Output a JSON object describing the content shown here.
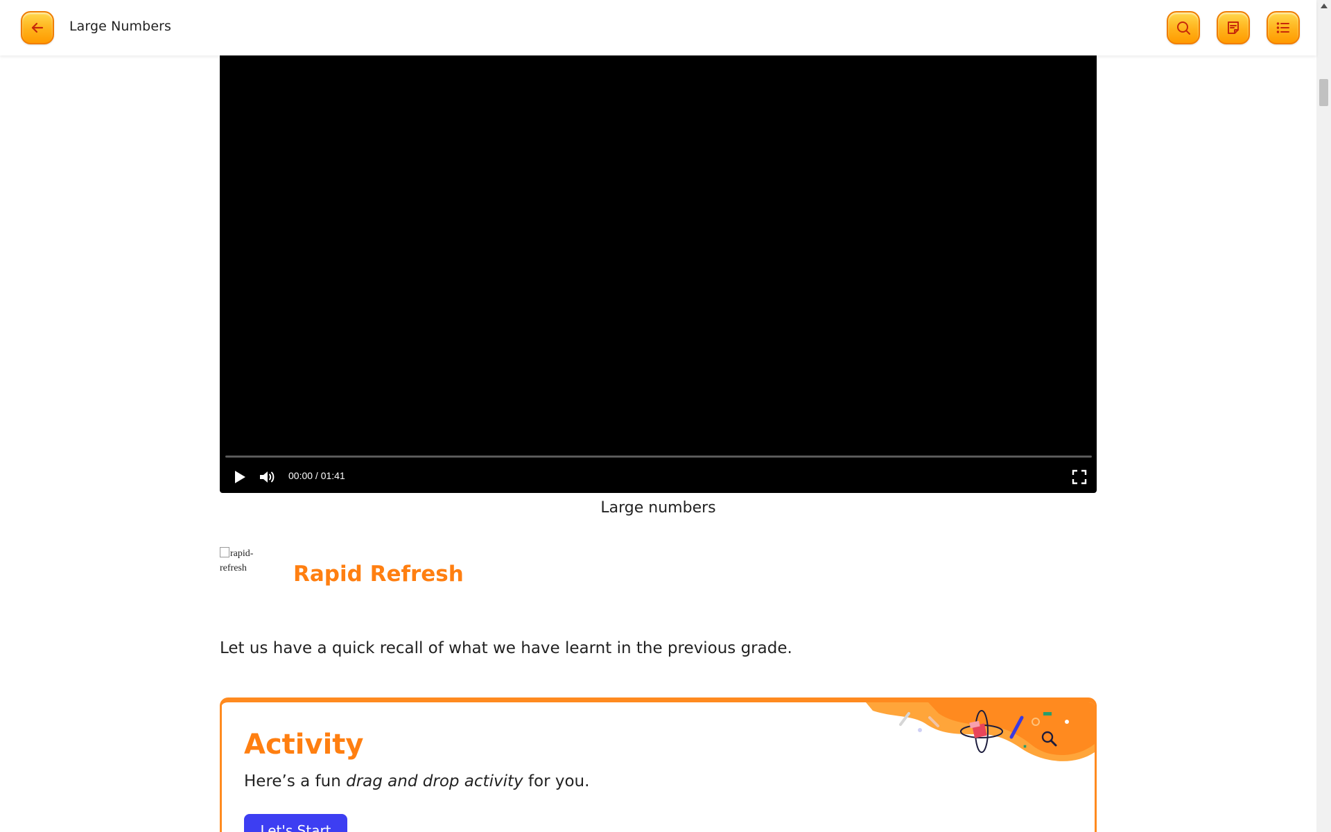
{
  "header": {
    "title": "Large Numbers",
    "back_icon": "arrow-left-icon",
    "search_icon": "search-icon",
    "notes_icon": "notes-icon",
    "menu_icon": "list-icon",
    "accent": "#ffb21a"
  },
  "video": {
    "time": "00:00 / 01:41",
    "progress": 0,
    "caption": "Large numbers"
  },
  "rapid_refresh": {
    "image_alt_line1": "rapid-",
    "image_alt_line2": "refresh",
    "title": "Rapid Refresh",
    "intro": "Let us have a quick recall of what we have learnt in the previous grade.",
    "accent": "#ff7f11"
  },
  "activity": {
    "title": "Activity",
    "desc_prefix": "Here’s a fun ",
    "desc_emphasis": "drag and drop activity",
    "desc_suffix": " for you.",
    "button_label": "Let's Start",
    "button_color": "#3d3ef2"
  }
}
